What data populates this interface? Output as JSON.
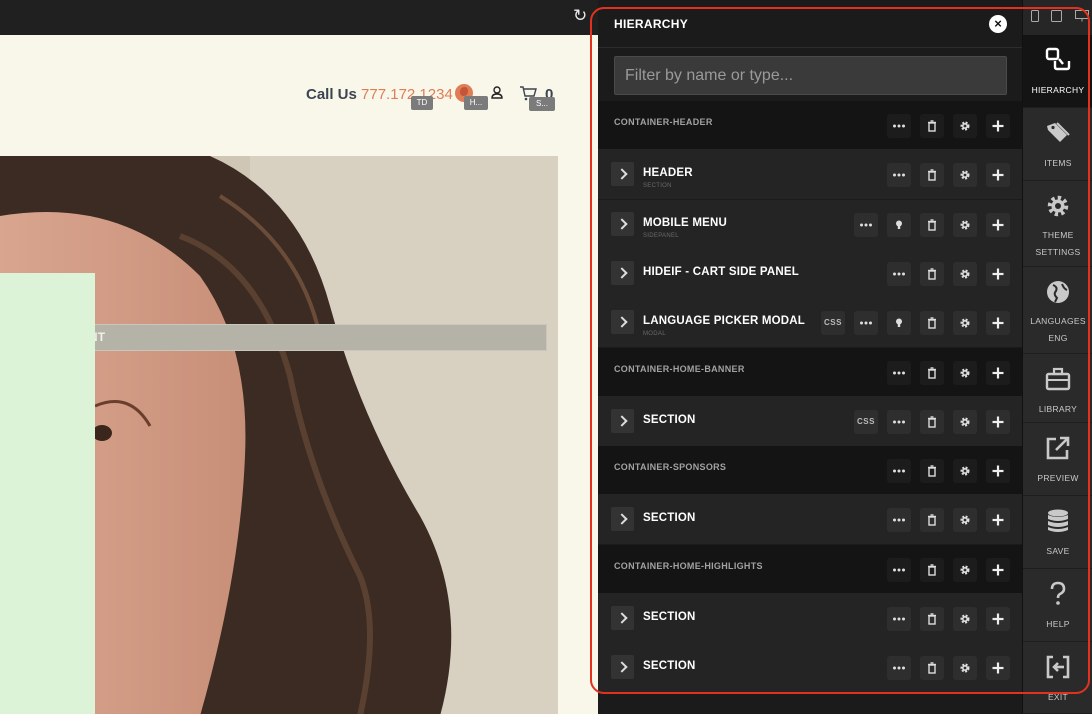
{
  "site": {
    "call_label": "Call Us ",
    "phone": "777.172.1234",
    "tags": {
      "td": "TD",
      "h": "H...",
      "s": "S..."
    },
    "cart_count": "0",
    "add_element_label": "D NEW ELEMENT",
    "icons": {
      "refresh": "refresh-icon",
      "globe": "globe-icon",
      "user": "user-icon",
      "cart": "cart-icon"
    },
    "colors": {
      "background": "#f9f7ea",
      "phone": "#e07d56",
      "green_box": "#dcf3d7"
    }
  },
  "panel": {
    "title": "HIERARCHY",
    "close_glyph": "×",
    "filter_placeholder": "Filter by name or type...",
    "rows": [
      {
        "kind": "container",
        "name": "CONTAINER-HEADER",
        "actions": [
          "more",
          "delete",
          "settings",
          "add"
        ]
      },
      {
        "kind": "element",
        "name": "HEADER",
        "type": "SECTION",
        "actions": [
          "more",
          "delete",
          "settings",
          "add"
        ]
      },
      {
        "kind": "element",
        "name": "MOBILE MENU",
        "type": "SIDEPANEL",
        "actions": [
          "more",
          "toggle",
          "delete",
          "settings",
          "add"
        ]
      },
      {
        "kind": "element",
        "name": "HIDEIF - CART SIDE PANEL",
        "type": "",
        "actions": [
          "more",
          "delete",
          "settings",
          "add"
        ]
      },
      {
        "kind": "element",
        "name": "LANGUAGE PICKER MODAL",
        "type": "MODAL",
        "actions": [
          "css",
          "more",
          "toggle",
          "delete",
          "settings",
          "add"
        ]
      },
      {
        "kind": "container",
        "name": "CONTAINER-HOME-BANNER",
        "actions": [
          "more",
          "delete",
          "settings",
          "add"
        ]
      },
      {
        "kind": "element",
        "name": "SECTION",
        "type": "",
        "actions": [
          "css",
          "more",
          "delete",
          "settings",
          "add"
        ]
      },
      {
        "kind": "container",
        "name": "CONTAINER-SPONSORS",
        "actions": [
          "more",
          "delete",
          "settings",
          "add"
        ]
      },
      {
        "kind": "element",
        "name": "SECTION",
        "type": "",
        "actions": [
          "more",
          "delete",
          "settings",
          "add"
        ]
      },
      {
        "kind": "container",
        "name": "CONTAINER-HOME-HIGHLIGHTS",
        "actions": [
          "more",
          "delete",
          "settings",
          "add"
        ]
      },
      {
        "kind": "element",
        "name": "SECTION",
        "type": "",
        "actions": [
          "more",
          "delete",
          "settings",
          "add"
        ]
      },
      {
        "kind": "element",
        "name": "SECTION",
        "type": "",
        "actions": [
          "more",
          "delete",
          "settings",
          "add"
        ]
      }
    ],
    "css_label": "CSS"
  },
  "toolbar": {
    "devices": [
      "phone-icon",
      "tablet-icon",
      "desktop-icon"
    ],
    "tools": [
      {
        "label": "HIERARCHY",
        "sub": "",
        "icon": "hierarchy-icon",
        "active": true
      },
      {
        "label": "ITEMS",
        "sub": "",
        "icon": "tags-icon",
        "active": false
      },
      {
        "label": "THEME",
        "sub": "SETTINGS",
        "icon": "gear-icon",
        "active": false
      },
      {
        "label": "LANGUAGES",
        "sub": "ENG",
        "icon": "globe-icon",
        "active": false
      },
      {
        "label": "LIBRARY",
        "sub": "",
        "icon": "briefcase-icon",
        "active": false
      },
      {
        "label": "PREVIEW",
        "sub": "",
        "icon": "external-link-icon",
        "active": false
      },
      {
        "label": "SAVE",
        "sub": "",
        "icon": "database-icon",
        "active": false
      },
      {
        "label": "HELP",
        "sub": "",
        "icon": "question-icon",
        "active": false
      },
      {
        "label": "EXIT",
        "sub": "",
        "icon": "exit-icon",
        "active": false
      }
    ]
  },
  "highlight_color": "#e2321e"
}
